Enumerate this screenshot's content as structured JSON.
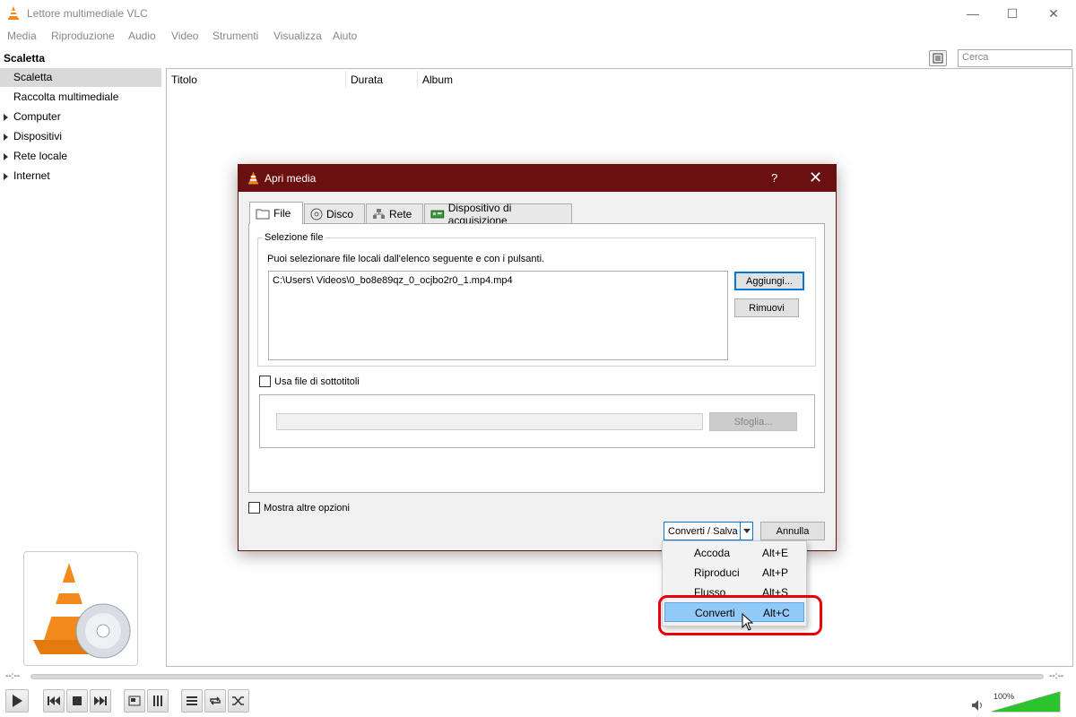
{
  "window": {
    "title": "Lettore multimediale VLC",
    "controls": {
      "minimize": "—",
      "maximize": "☐",
      "close": "✕"
    }
  },
  "menu": [
    "Media",
    "Riproduzione",
    "Audio",
    "Video",
    "Strumenti",
    "Visualizza",
    "Aiuto"
  ],
  "sidebar": {
    "heading": "Scaletta",
    "items": [
      {
        "label": "Scaletta",
        "selected": true,
        "expandable": false
      },
      {
        "label": "Raccolta multimediale",
        "selected": false,
        "expandable": false
      },
      {
        "label": "Computer",
        "selected": false,
        "expandable": true
      },
      {
        "label": "Dispositivi",
        "selected": false,
        "expandable": true
      },
      {
        "label": "Rete locale",
        "selected": false,
        "expandable": true
      },
      {
        "label": "Internet",
        "selected": false,
        "expandable": true
      }
    ]
  },
  "playlist": {
    "search_placeholder": "Cerca",
    "columns": [
      "Titolo",
      "Durata",
      "Album"
    ]
  },
  "player": {
    "elapsed": "--:--",
    "remaining": "--:--",
    "volume": "100%",
    "volume_level": 1.0
  },
  "dialog": {
    "title": "Apri media",
    "help": "?",
    "close": "✕",
    "tabs": [
      {
        "label": "File",
        "icon": "folder-icon",
        "active": true
      },
      {
        "label": "Disco",
        "icon": "disc-icon",
        "active": false
      },
      {
        "label": "Rete",
        "icon": "network-icon",
        "active": false
      },
      {
        "label": "Dispositivo di acquisizione",
        "icon": "capture-card-icon",
        "active": false
      }
    ],
    "file_group": {
      "title": "Selezione file",
      "description": "Puoi selezionare file locali dall'elenco seguente e con i pulsanti.",
      "files": [
        "C:\\Users\\      Videos\\0_bo8e89qz_0_ocjbo2r0_1.mp4.mp4"
      ],
      "add_button": "Aggiungi...",
      "remove_button": "Rimuovi"
    },
    "subtitles": {
      "checkbox_label": "Usa file di sottotitoli",
      "checked": false,
      "browse_button": "Sfoglia..."
    },
    "more_options": {
      "label": "Mostra altre opzioni",
      "checked": false
    },
    "convert_button": "Converti / Salva",
    "cancel_button": "Annulla"
  },
  "dropdown": {
    "items": [
      {
        "label": "Accoda",
        "shortcut": "Alt+E",
        "highlighted": false
      },
      {
        "label": "Riproduci",
        "shortcut": "Alt+P",
        "highlighted": false
      },
      {
        "label": "Flusso",
        "shortcut": "Alt+S",
        "highlighted": false
      },
      {
        "label": "Converti",
        "shortcut": "Alt+C",
        "highlighted": true
      }
    ]
  },
  "colors": {
    "dialog_title_bg": "#6b1010",
    "menu_highlight": "#91c9f7",
    "annotation_red": "#e8000c",
    "vlc_orange": "#f28a1e"
  }
}
